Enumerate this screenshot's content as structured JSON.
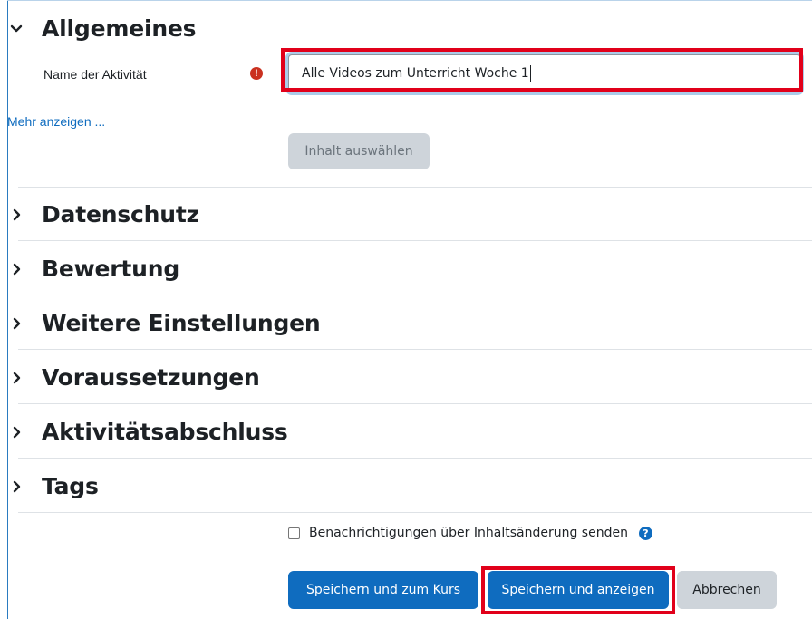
{
  "general": {
    "title": "Allgemeines",
    "name_label": "Name der Aktivität",
    "name_value": "Alle Videos zum Unterricht Woche 1",
    "required_icon": "exclamation-circle-icon",
    "show_more_link": "Mehr anzeigen ...",
    "choose_content_button": "Inhalt auswählen"
  },
  "sections": [
    {
      "title": "Datenschutz"
    },
    {
      "title": "Bewertung"
    },
    {
      "title": "Weitere Einstellungen"
    },
    {
      "title": "Voraussetzungen"
    },
    {
      "title": "Aktivitätsabschluss"
    },
    {
      "title": "Tags"
    }
  ],
  "notify": {
    "label": "Benachrichtigungen über Inhaltsänderung senden",
    "checked": false,
    "help_icon": "question-circle-icon"
  },
  "actions": {
    "save_return": "Speichern und zum Kurs",
    "save_display": "Speichern und anzeigen",
    "cancel": "Abbrechen"
  },
  "colors": {
    "primary": "#0f6cbf",
    "highlight": "#e1001a",
    "required": "#ca3120",
    "secondary": "#ced4da"
  }
}
